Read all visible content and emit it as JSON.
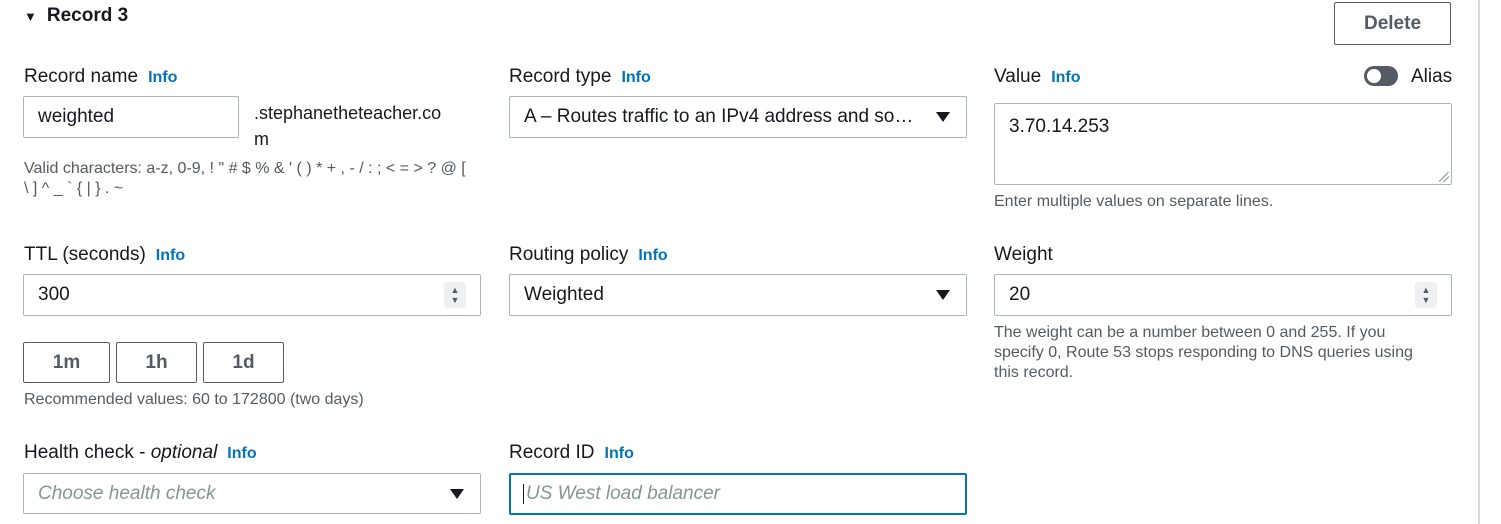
{
  "record": {
    "title": "Record 3",
    "delete_label": "Delete",
    "info_label": "Info"
  },
  "record_name": {
    "label": "Record name",
    "value": "weighted",
    "domain_suffix_line1": ".stephanetheteacher.co",
    "domain_suffix_line2": "m",
    "hint_line1": "Valid characters: a-z, 0-9, ! \" # $ % & ' ( ) * + , - / : ; < = > ? @ [",
    "hint_line2": "\\ ] ^ _ ` { | } . ~"
  },
  "record_type": {
    "label": "Record type",
    "selected": "A – Routes traffic to an IPv4 address and so…"
  },
  "value": {
    "label": "Value",
    "text": "3.70.14.253",
    "hint": "Enter multiple values on separate lines.",
    "alias_label": "Alias",
    "alias_enabled": false
  },
  "ttl": {
    "label": "TTL (seconds)",
    "value": "300",
    "presets": [
      "1m",
      "1h",
      "1d"
    ],
    "hint": "Recommended values: 60 to 172800 (two days)"
  },
  "routing_policy": {
    "label": "Routing policy",
    "selected": "Weighted"
  },
  "weight": {
    "label": "Weight",
    "value": "20",
    "hint_line1": "The weight can be a number between 0 and 255. If you",
    "hint_line2": "specify 0, Route 53 stops responding to DNS queries using",
    "hint_line3": "this record."
  },
  "health_check": {
    "label": "Health check - ",
    "label_optional": "optional",
    "placeholder": "Choose health check"
  },
  "record_id": {
    "label": "Record ID",
    "placeholder": "US West load balancer"
  }
}
